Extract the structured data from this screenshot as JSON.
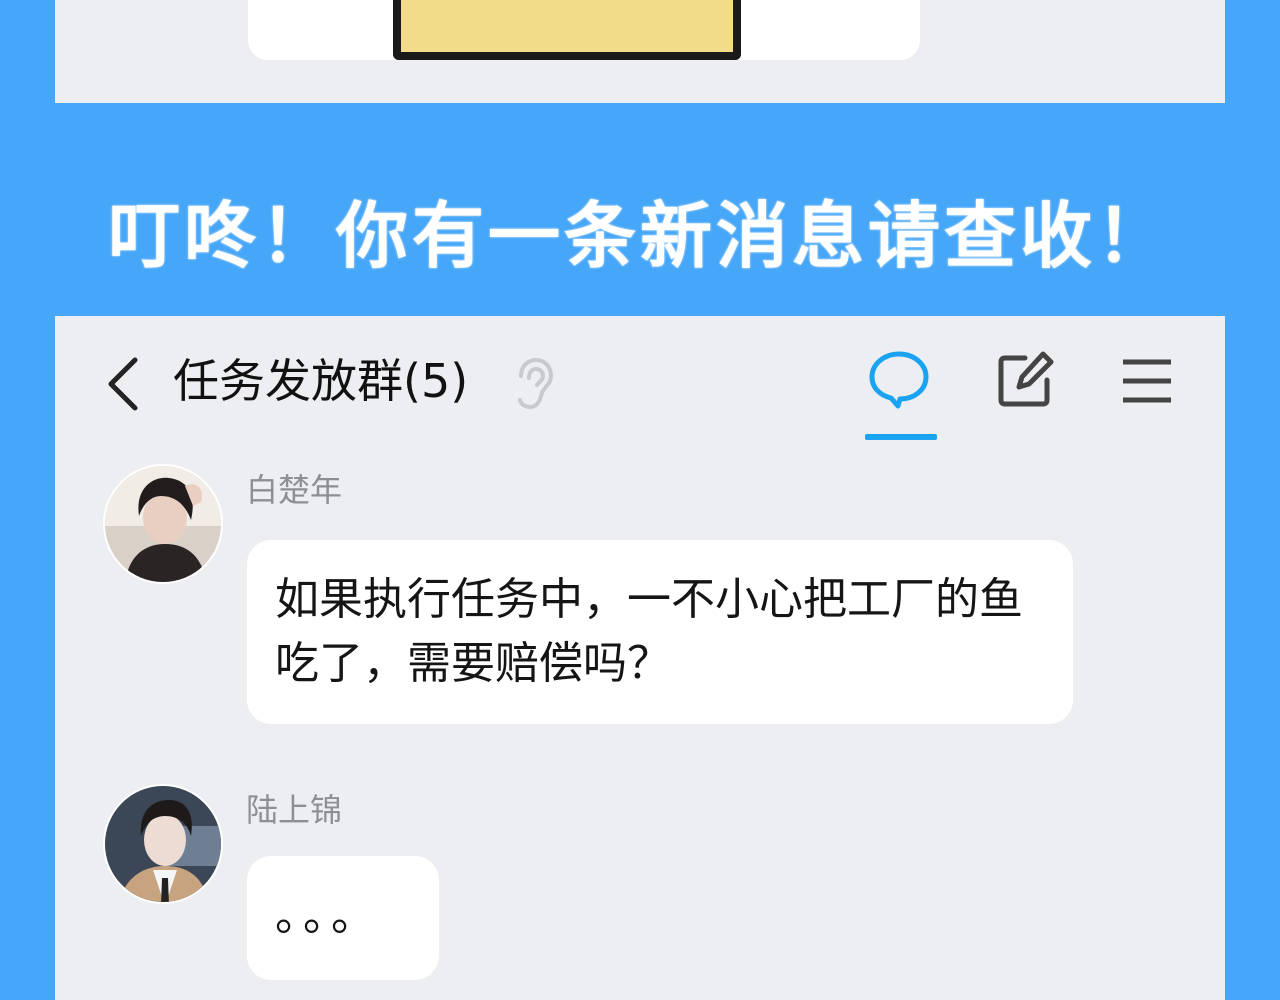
{
  "colors": {
    "background": "#46a6f8",
    "panel": "#eceef1",
    "bubble": "#ffffff",
    "accent": "#1aa3f2",
    "title_text": "#ffffff"
  },
  "headline": "叮咚！你有一条新消息请查收！",
  "chat": {
    "title": "任务发放群(5)",
    "icons": [
      "back-chevron-icon",
      "ear-icon",
      "chat-bubble-icon",
      "edit-icon",
      "menu-icon"
    ],
    "active_tab": "chat",
    "messages": [
      {
        "sender": "白楚年",
        "text": "如果执行任务中，一不小心把工厂的鱼吃了，需要赔偿吗？"
      },
      {
        "sender": "陆上锦",
        "text": "。。。"
      }
    ]
  }
}
